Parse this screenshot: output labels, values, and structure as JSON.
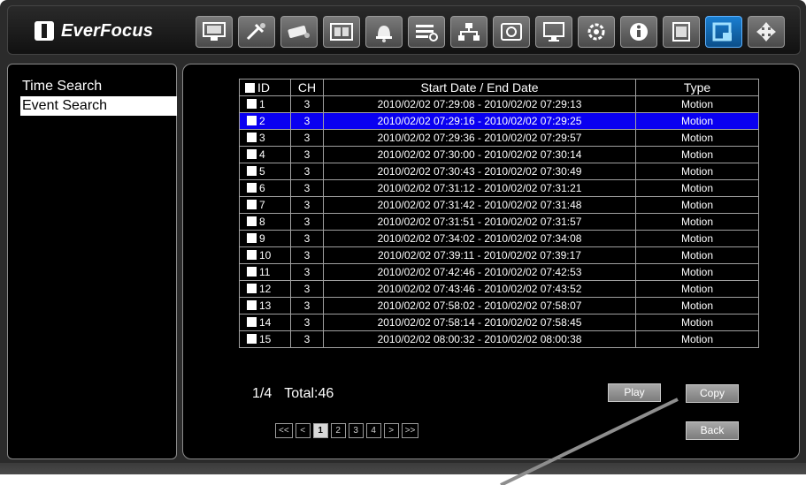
{
  "brand": {
    "name": "EverFocus"
  },
  "toolbar": {
    "icons": [
      "monitor-icon",
      "tools-icon",
      "camera-icon",
      "film-icon",
      "alarm-bell-icon",
      "record-schedule-icon",
      "network-icon",
      "disk-icon",
      "display-icon",
      "settings-gear-icon",
      "info-icon",
      "archive-icon",
      "search-icon",
      "ptz-move-icon"
    ],
    "active_icon": "search-icon"
  },
  "left_menu": {
    "items": [
      "Time Search",
      "Event Search"
    ],
    "selected": "Event Search"
  },
  "table": {
    "headers": {
      "id": "ID",
      "ch": "CH",
      "date": "Start Date / End Date",
      "type": "Type"
    },
    "selected_id": "2",
    "rows": [
      {
        "id": "1",
        "ch": "3",
        "date": "2010/02/02 07:29:08 - 2010/02/02 07:29:13",
        "type": "Motion"
      },
      {
        "id": "2",
        "ch": "3",
        "date": "2010/02/02 07:29:16 - 2010/02/02 07:29:25",
        "type": "Motion"
      },
      {
        "id": "3",
        "ch": "3",
        "date": "2010/02/02 07:29:36 - 2010/02/02 07:29:57",
        "type": "Motion"
      },
      {
        "id": "4",
        "ch": "3",
        "date": "2010/02/02 07:30:00 - 2010/02/02 07:30:14",
        "type": "Motion"
      },
      {
        "id": "5",
        "ch": "3",
        "date": "2010/02/02 07:30:43 - 2010/02/02 07:30:49",
        "type": "Motion"
      },
      {
        "id": "6",
        "ch": "3",
        "date": "2010/02/02 07:31:12 - 2010/02/02 07:31:21",
        "type": "Motion"
      },
      {
        "id": "7",
        "ch": "3",
        "date": "2010/02/02 07:31:42 - 2010/02/02 07:31:48",
        "type": "Motion"
      },
      {
        "id": "8",
        "ch": "3",
        "date": "2010/02/02 07:31:51 - 2010/02/02 07:31:57",
        "type": "Motion"
      },
      {
        "id": "9",
        "ch": "3",
        "date": "2010/02/02 07:34:02 - 2010/02/02 07:34:08",
        "type": "Motion"
      },
      {
        "id": "10",
        "ch": "3",
        "date": "2010/02/02 07:39:11 - 2010/02/02 07:39:17",
        "type": "Motion"
      },
      {
        "id": "11",
        "ch": "3",
        "date": "2010/02/02 07:42:46 - 2010/02/02 07:42:53",
        "type": "Motion"
      },
      {
        "id": "12",
        "ch": "3",
        "date": "2010/02/02 07:43:46 - 2010/02/02 07:43:52",
        "type": "Motion"
      },
      {
        "id": "13",
        "ch": "3",
        "date": "2010/02/02 07:58:02 - 2010/02/02 07:58:07",
        "type": "Motion"
      },
      {
        "id": "14",
        "ch": "3",
        "date": "2010/02/02 07:58:14 - 2010/02/02 07:58:45",
        "type": "Motion"
      },
      {
        "id": "15",
        "ch": "3",
        "date": "2010/02/02 08:00:32 - 2010/02/02 08:00:38",
        "type": "Motion"
      }
    ]
  },
  "paging": {
    "page": "1/4",
    "total": "Total:46",
    "buttons": [
      "<<",
      "<",
      "1",
      "2",
      "3",
      "4",
      ">",
      ">>"
    ],
    "current": "1"
  },
  "actions": {
    "play": "Play",
    "copy": "Copy",
    "back": "Back"
  },
  "colors": {
    "selected_row": "#0a00f0",
    "active_icon": "#1a7fd1",
    "background": "#000000",
    "frame": "#2b2b2b"
  }
}
